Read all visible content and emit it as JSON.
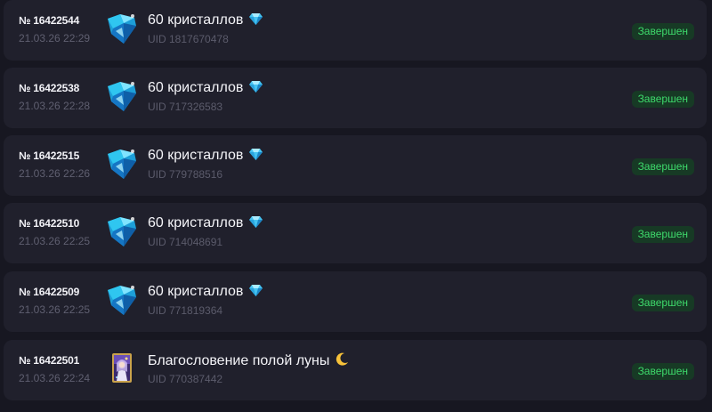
{
  "orders": [
    {
      "number": "№ 16422544",
      "datetime": "21.03.26 22:29",
      "product": "60 кристаллов",
      "product_emoji": "gem-icon",
      "product_icon": "crystal-pack-icon",
      "uid": "UID 1817670478",
      "status": "Завершен"
    },
    {
      "number": "№ 16422538",
      "datetime": "21.03.26 22:28",
      "product": "60 кристаллов",
      "product_emoji": "gem-icon",
      "product_icon": "crystal-pack-icon",
      "uid": "UID 717326583",
      "status": "Завершен"
    },
    {
      "number": "№ 16422515",
      "datetime": "21.03.26 22:26",
      "product": "60 кристаллов",
      "product_emoji": "gem-icon",
      "product_icon": "crystal-pack-icon",
      "uid": "UID 779788516",
      "status": "Завершен"
    },
    {
      "number": "№ 16422510",
      "datetime": "21.03.26 22:25",
      "product": "60 кристаллов",
      "product_emoji": "gem-icon",
      "product_icon": "crystal-pack-icon",
      "uid": "UID 714048691",
      "status": "Завершен"
    },
    {
      "number": "№ 16422509",
      "datetime": "21.03.26 22:25",
      "product": "60 кристаллов",
      "product_emoji": "gem-icon",
      "product_icon": "crystal-pack-icon",
      "uid": "UID 771819364",
      "status": "Завершен"
    },
    {
      "number": "№ 16422501",
      "datetime": "21.03.26 22:24",
      "product": "Благословение полой луны",
      "product_emoji": "crescent-moon-icon",
      "product_icon": "blessing-card-icon",
      "uid": "UID 770387442",
      "status": "Завершен"
    }
  ],
  "colors": {
    "background": "#171721",
    "card": "#20202c",
    "status_text": "#3ed96b",
    "status_bg": "#173a25"
  }
}
